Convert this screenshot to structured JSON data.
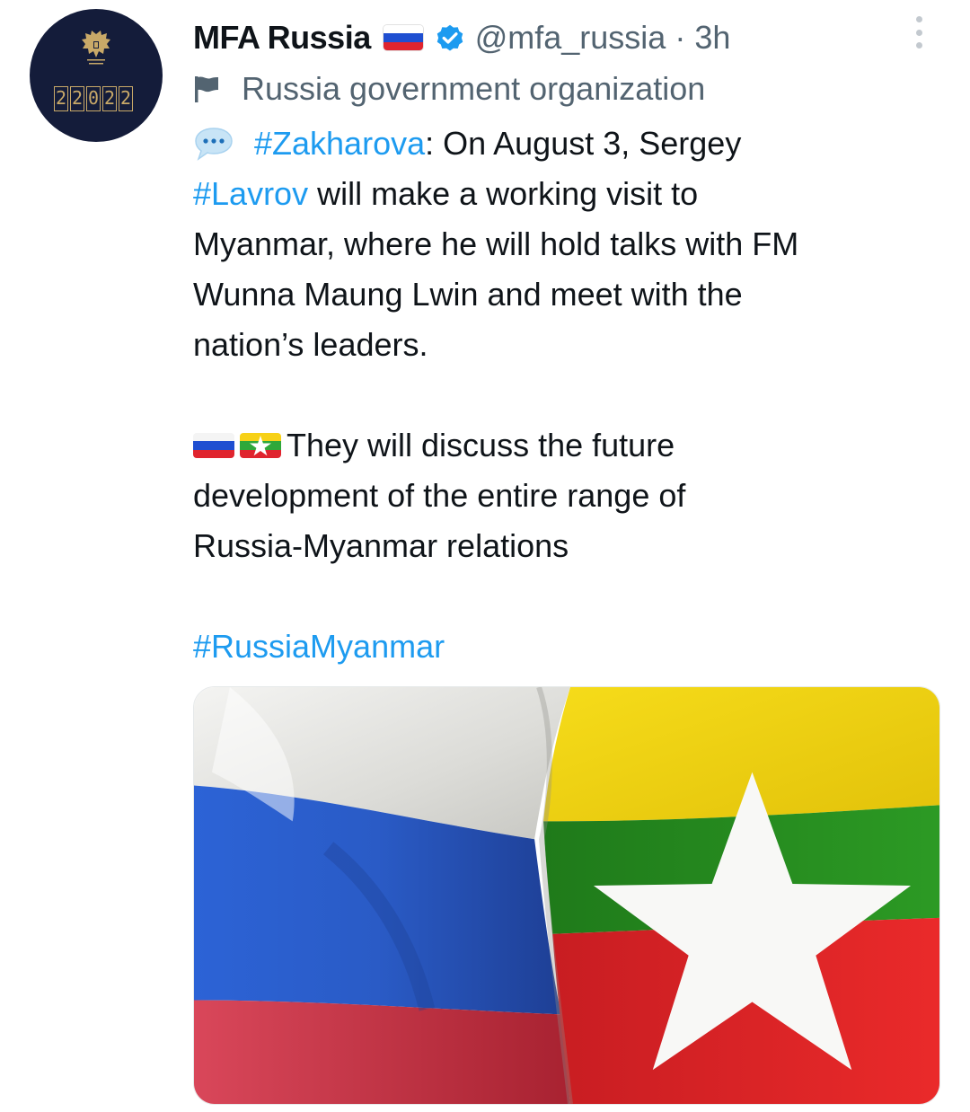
{
  "author": {
    "name": "MFA Russia",
    "handle": "@mfa_russia",
    "time": "3h",
    "separator": "·",
    "label": "Russia government organization",
    "avatar_digits": [
      "2",
      "2",
      "0",
      "2",
      "2"
    ]
  },
  "tweet": {
    "hashtag_zakharova": "#Zakharova",
    "line1_rest": ": On August 3, Sergey",
    "hashtag_lavrov": "#Lavrov",
    "line2_rest": " will make a working visit to",
    "line3": "Myanmar, where he will hold talks with FM",
    "line4": "Wunna Maung Lwin and meet with the",
    "line5": "nation’s leaders.",
    "para2_line1": "They will discuss the future",
    "para2_line2": "development of the entire range of",
    "para2_line3": "Russia-Myanmar relations",
    "hashtag_final": "#RussiaMyanmar"
  },
  "icons": {
    "verified": "verified-badge-icon",
    "more": "more-options-icon",
    "org_flag": "flag-icon",
    "speech": "speech-bubble-icon",
    "russia_flag": "russia-flag-icon",
    "myanmar_flag": "myanmar-flag-icon"
  },
  "colors": {
    "link": "#1d9bf0",
    "secondary_text": "#536471",
    "primary_text": "#0f1419",
    "verified": "#1d9bf0"
  }
}
